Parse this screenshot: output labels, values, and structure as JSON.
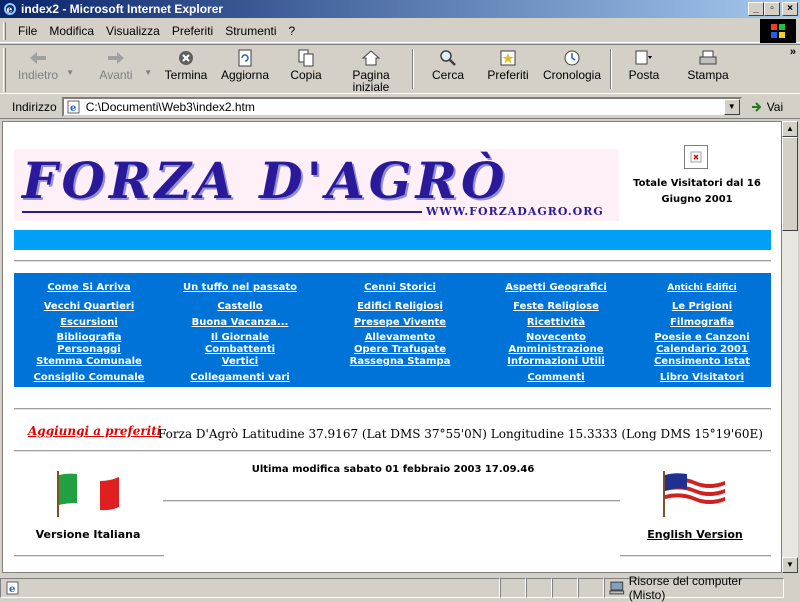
{
  "window": {
    "title": "index2 - Microsoft Internet Explorer"
  },
  "menu": {
    "items": [
      "File",
      "Modifica",
      "Visualizza",
      "Preferiti",
      "Strumenti",
      "?"
    ]
  },
  "toolbar": {
    "back": "Indietro",
    "forward": "Avanti",
    "stop": "Termina",
    "refresh": "Aggiorna",
    "copy": "Copia",
    "home_line1": "Pagina",
    "home_line2": "iniziale",
    "search": "Cerca",
    "favorites": "Preferiti",
    "history": "Cronologia",
    "mail": "Posta",
    "print": "Stampa"
  },
  "address": {
    "label": "Indirizzo",
    "value": "C:\\Documenti\\Web3\\index2.htm",
    "go": "Vai"
  },
  "page": {
    "logo_title": "FORZA D'AGRÒ",
    "logo_url": "WWW.FORZADAGRO.ORG",
    "visitors_label": "Totale Visitatori dal 16 Giugno 2001",
    "nav": {
      "c1": [
        "Come Si Arriva",
        "Vecchi Quartieri",
        "Escursioni",
        "Bibliografia",
        "Personaggi",
        "Stemma Comunale",
        "Consiglio Comunale"
      ],
      "c2": [
        "Un tuffo nel passato",
        "Castello",
        "Buona Vacanza...",
        "Il Giornale",
        "Combattenti",
        "Vertici",
        "Collegamenti vari"
      ],
      "c3": [
        "Cenni Storici",
        "Edifici Religiosi",
        "Presepe Vivente",
        "Allevamento",
        "Opere Trafugate",
        "Rassegna Stampa"
      ],
      "c4": [
        "Aspetti Geografici",
        "Feste Religiose",
        "Ricettività",
        "Novecento",
        "Amministrazione",
        "Informazioni Utili",
        "Commenti"
      ],
      "c5": [
        "Antichi Edifici",
        "Le Prigioni",
        "Filmografia",
        "Poesie e Canzoni",
        "Calendario 2001",
        "Censimento Istat",
        "Libro Visitatori"
      ]
    },
    "add_favorites": "Aggiungi a preferiti",
    "coordinates": "Forza D'Agrò Latitudine 37.9167 (Lat DMS 37°55'0N) Longitudine 15.3333 (Long DMS 15°19'60E)",
    "last_modified": "Ultima modifica sabato 01 febbraio 2003 17.09.46",
    "italian_version": "Versione Italiana",
    "english_version": "English Version"
  },
  "status": {
    "zone": "Risorse del computer (Misto)"
  },
  "colors": {
    "nav_bg": "#0073d8",
    "blue_bar": "#00a0f8",
    "logo_text": "#2a1a9a",
    "link_red": "#e00000"
  }
}
